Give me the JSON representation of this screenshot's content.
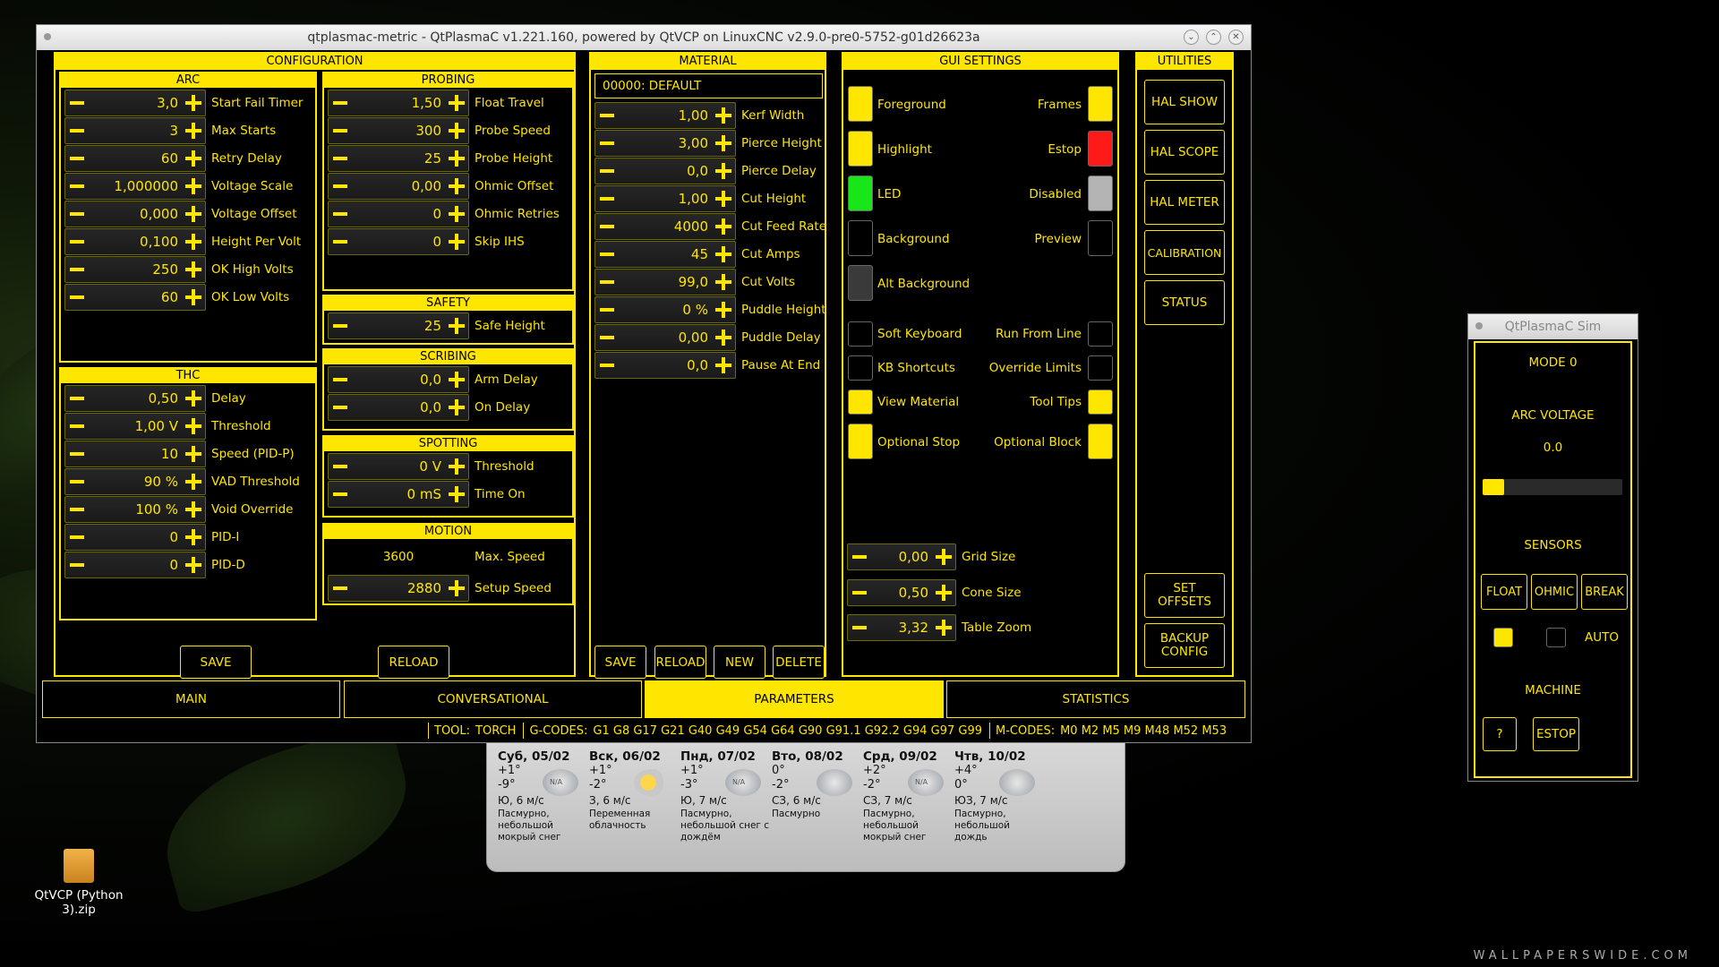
{
  "window": {
    "title": "qtplasmac-metric - QtPlasmaC v1.221.160, powered by QtVCP on LinuxCNC v2.9.0-pre0-5752-g01d26623a",
    "ctl_min": "⌄",
    "ctl_max": "⌃",
    "ctl_close": "✕"
  },
  "config": {
    "title": "CONFIGURATION",
    "arc": {
      "title": "ARC",
      "rows": [
        {
          "value": "3,0",
          "label": "Start Fail Timer"
        },
        {
          "value": "3",
          "label": "Max Starts"
        },
        {
          "value": "60",
          "label": "Retry Delay"
        },
        {
          "value": "1,000000",
          "label": "Voltage Scale"
        },
        {
          "value": "0,000",
          "label": "Voltage Offset"
        },
        {
          "value": "0,100",
          "label": "Height Per Volt"
        },
        {
          "value": "250",
          "label": "OK High Volts"
        },
        {
          "value": "60",
          "label": "OK Low Volts"
        }
      ]
    },
    "thc": {
      "title": "THC",
      "rows": [
        {
          "value": "0,50",
          "label": "Delay"
        },
        {
          "value": "1,00 V",
          "label": "Threshold"
        },
        {
          "value": "10",
          "label": "Speed (PID-P)"
        },
        {
          "value": "90 %",
          "label": "VAD Threshold"
        },
        {
          "value": "100 %",
          "label": "Void Override"
        },
        {
          "value": "0",
          "label": "PID-I"
        },
        {
          "value": "0",
          "label": "PID-D"
        }
      ]
    },
    "probing": {
      "title": "PROBING",
      "rows": [
        {
          "value": "1,50",
          "label": "Float Travel"
        },
        {
          "value": "300",
          "label": "Probe Speed"
        },
        {
          "value": "25",
          "label": "Probe Height"
        },
        {
          "value": "0,00",
          "label": "Ohmic Offset"
        },
        {
          "value": "0",
          "label": "Ohmic Retries"
        },
        {
          "value": "0",
          "label": "Skip IHS"
        }
      ]
    },
    "safety": {
      "title": "SAFETY",
      "rows": [
        {
          "value": "25",
          "label": "Safe Height"
        }
      ]
    },
    "scribing": {
      "title": "SCRIBING",
      "rows": [
        {
          "value": "0,0",
          "label": "Arm Delay"
        },
        {
          "value": "0,0",
          "label": "On Delay"
        }
      ]
    },
    "spotting": {
      "title": "SPOTTING",
      "rows": [
        {
          "value": "0 V",
          "label": "Threshold"
        },
        {
          "value": "0 mS",
          "label": "Time On"
        }
      ]
    },
    "motion": {
      "title": "MOTION",
      "max_value": "3600",
      "max_label": "Max. Speed",
      "setup_value": "2880",
      "setup_label": "Setup Speed"
    },
    "save": "SAVE",
    "reload": "RELOAD"
  },
  "material": {
    "title": "MATERIAL",
    "name": "00000: DEFAULT",
    "rows": [
      {
        "value": "1,00",
        "label": "Kerf Width"
      },
      {
        "value": "3,00",
        "label": "Pierce Height"
      },
      {
        "value": "0,0",
        "label": "Pierce Delay"
      },
      {
        "value": "1,00",
        "label": "Cut Height"
      },
      {
        "value": "4000",
        "label": "Cut Feed Rate"
      },
      {
        "value": "45",
        "label": "Cut Amps"
      },
      {
        "value": "99,0",
        "label": "Cut Volts"
      },
      {
        "value": "0 %",
        "label": "Puddle Height"
      },
      {
        "value": "0,00",
        "label": "Puddle Delay"
      },
      {
        "value": "0,0",
        "label": "Pause At End"
      }
    ],
    "save": "SAVE",
    "reload": "RELOAD",
    "new": "NEW",
    "delete": "DELETE"
  },
  "gui": {
    "title": "GUI SETTINGS",
    "foreground": "Foreground",
    "frames": "Frames",
    "highlight": "Highlight",
    "estop": "Estop",
    "led": "LED",
    "disabled": "Disabled",
    "background": "Background",
    "preview": "Preview",
    "alt_background": "Alt Background",
    "soft_keyboard": "Soft Keyboard",
    "run_from_line": "Run From Line",
    "kb_shortcuts": "KB Shortcuts",
    "override_limits": "Override Limits",
    "view_material": "View Material",
    "tool_tips": "Tool Tips",
    "optional_stop": "Optional Stop",
    "optional_block": "Optional Block",
    "grid_value": "0,00",
    "grid_label": "Grid Size",
    "cone_value": "0,50",
    "cone_label": "Cone Size",
    "zoom_value": "3,32",
    "zoom_label": "Table Zoom",
    "colors": {
      "yellow": "#ffe600",
      "red": "#ff1a1a",
      "green": "#19e619",
      "grey": "#b4b4b4",
      "dark": "#000000",
      "alt": "#3a3a3a"
    }
  },
  "utilities": {
    "title": "UTILITIES",
    "hal_show": "HAL SHOW",
    "hal_scope": "HAL SCOPE",
    "hal_meter": "HAL METER",
    "calibration": "CALIBRATION",
    "status": "STATUS",
    "set_offsets_1": "SET",
    "set_offsets_2": "OFFSETS",
    "backup_1": "BACKUP",
    "backup_2": "CONFIG"
  },
  "tabs": [
    "MAIN",
    "CONVERSATIONAL",
    "PARAMETERS",
    "STATISTICS"
  ],
  "status": {
    "tool_label": "TOOL:",
    "tool": "TORCH",
    "gcodes_label": "G-CODES:",
    "gcodes": "G1 G8 G17 G21 G40 G49 G54 G64 G90 G91.1 G92.2 G94 G97 G99",
    "mcodes_label": "M-CODES:",
    "mcodes": "M0 M2 M5 M9 M48 M52 M53"
  },
  "sim": {
    "title": "QtPlasmaC Sim",
    "mode": "MODE 0",
    "arc_voltage": "ARC VOLTAGE",
    "arc_value": "0.0",
    "sensors": "SENSORS",
    "float": "FLOAT",
    "ohmic": "OHMIC",
    "break": "BREAK",
    "auto": "AUTO",
    "machine": "MACHINE",
    "help": "?",
    "estop": "ESTOP"
  },
  "weather": [
    {
      "day": "Суб, 05/02",
      "hi": "+1°",
      "lo": "-9°",
      "wind": "Ю, 6 м/с",
      "cond": "Пасмурно, небольшой мокрый снег",
      "icon": "na"
    },
    {
      "day": "Вск, 06/02",
      "hi": "+1°",
      "lo": "-2°",
      "wind": "З, 6 м/с",
      "cond": "Переменная облачность",
      "icon": "sun"
    },
    {
      "day": "Пнд, 07/02",
      "hi": "+1°",
      "lo": "-3°",
      "wind": "Ю, 7 м/с",
      "cond": "Пасмурно, небольшой снег с дождём",
      "icon": "na"
    },
    {
      "day": "Вто, 08/02",
      "hi": "0°",
      "lo": "-2°",
      "wind": "СЗ, 6 м/с",
      "cond": "Пасмурно",
      "icon": "cloud"
    },
    {
      "day": "Срд, 09/02",
      "hi": "+2°",
      "lo": "-2°",
      "wind": "СЗ, 7 м/с",
      "cond": "Пасмурно, небольшой мокрый снег",
      "icon": "na"
    },
    {
      "day": "Чтв, 10/02",
      "hi": "+4°",
      "lo": "0°",
      "wind": "ЮЗ, 7 м/с",
      "cond": "Пасмурно, небольшой дождь",
      "icon": "cloud"
    }
  ],
  "desktop": {
    "zip_label": "QtVCP (Python 3).zip",
    "watermark": "WALLPAPERSWIDE.COM",
    "na": "N/A"
  }
}
